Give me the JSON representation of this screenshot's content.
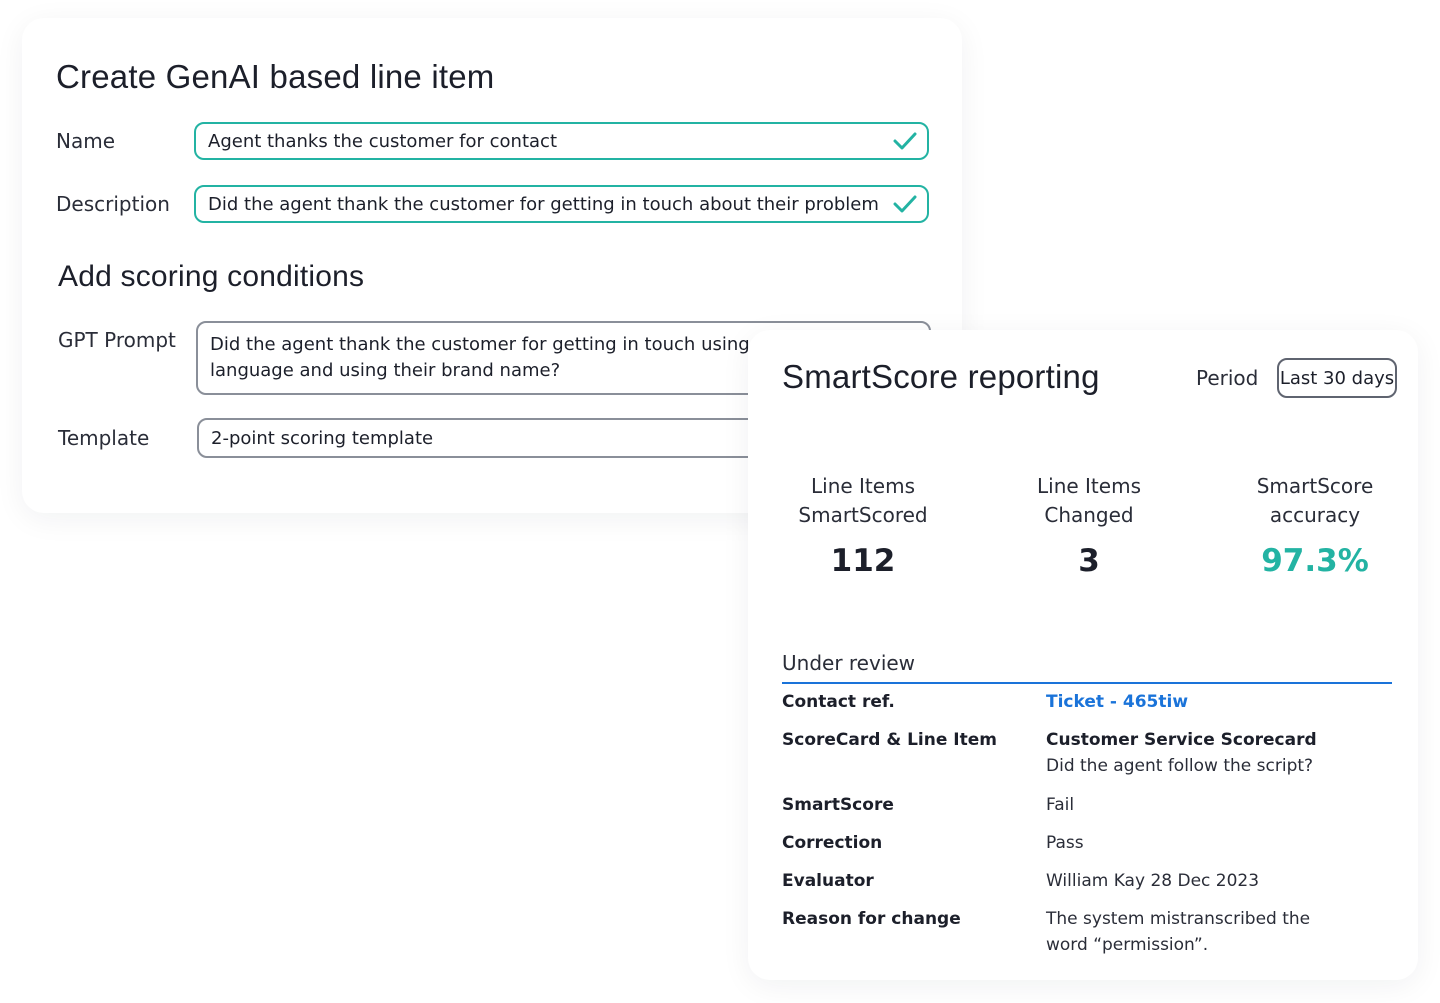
{
  "create": {
    "title": "Create GenAI based line item",
    "name_label": "Name",
    "name_value": "Agent thanks the customer for contact",
    "description_label": "Description",
    "description_value": "Did the agent thank the customer for getting in touch about their problem",
    "scoring_title": "Add scoring conditions",
    "gpt_label": "GPT Prompt",
    "gpt_value": "Did the agent thank the customer for getting in touch using ap\nlanguage and using their brand name?",
    "template_label": "Template",
    "template_value": "2-point scoring template"
  },
  "report": {
    "title": "SmartScore reporting",
    "period_label": "Period",
    "period_value": "Last 30 days",
    "stats": [
      {
        "label": "Line Items\nSmartScored",
        "value": "112"
      },
      {
        "label": "Line Items\nChanged",
        "value": "3"
      },
      {
        "label": "SmartScore\naccuracy",
        "value": "97.3%"
      }
    ],
    "review_heading": "Under review",
    "rows": {
      "contact_key": "Contact ref.",
      "contact_val": "Ticket - 465tiw",
      "scorecard_key": "ScoreCard & Line Item",
      "scorecard_val_title": "Customer Service Scorecard",
      "scorecard_val_sub": "Did the agent follow the script?",
      "smartscore_key": "SmartScore",
      "smartscore_val": "Fail",
      "correction_key": "Correction",
      "correction_val": "Pass",
      "evaluator_key": "Evaluator",
      "evaluator_val": "William Kay 28 Dec 2023",
      "reason_key": "Reason for change",
      "reason_val": "The system mistranscribed the\nword “permission”."
    }
  },
  "colors": {
    "accent": "#23b3a3",
    "link": "#1a73d9",
    "divider": "#1a73d9"
  },
  "icons": {
    "valid": "check-icon"
  }
}
